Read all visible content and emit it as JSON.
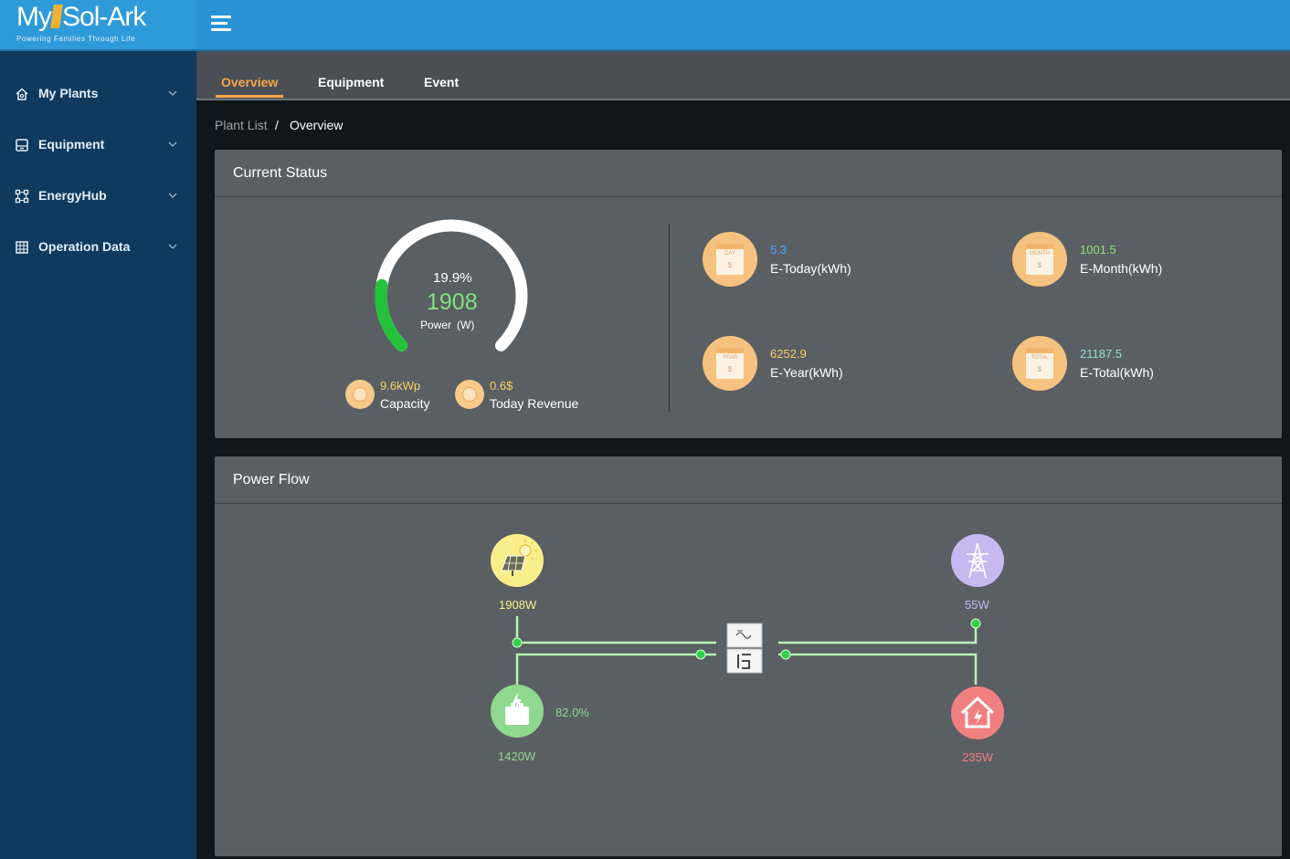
{
  "app": {
    "logo_text_a": "My",
    "logo_text_b": "Sol-Ark",
    "logo_tagline": "Powering Families Through Life"
  },
  "sidebar": {
    "items": [
      {
        "label": "My Plants",
        "icon": "home-icon"
      },
      {
        "label": "Equipment",
        "icon": "equipment-icon"
      },
      {
        "label": "EnergyHub",
        "icon": "network-icon"
      },
      {
        "label": "Operation Data",
        "icon": "grid-table-icon"
      }
    ]
  },
  "tabs": [
    {
      "label": "Overview",
      "active": true
    },
    {
      "label": "Equipment",
      "active": false
    },
    {
      "label": "Event",
      "active": false
    }
  ],
  "breadcrumb": {
    "parent": "Plant List",
    "separator": "/",
    "current": "Overview"
  },
  "current_status": {
    "title": "Current Status",
    "gauge": {
      "percent_text": "19.9%",
      "percent_value": 19.9,
      "value": "1908",
      "label": "Power",
      "unit": "(W)"
    },
    "capacity": {
      "value": "9.6kWp",
      "label": "Capacity"
    },
    "revenue": {
      "value": "0.6$",
      "label": "Today Revenue"
    },
    "stats": [
      {
        "value": "5.3",
        "label": "E-Today(kWh)",
        "caption": "DAY",
        "color": "#4fa8ff"
      },
      {
        "value": "1001.5",
        "label": "E-Month(kWh)",
        "caption": "MONTH",
        "color": "#8fe07f"
      },
      {
        "value": "6252.9",
        "label": "E-Year(kWh)",
        "caption": "YEAR",
        "color": "#f8d26a"
      },
      {
        "value": "21187.5",
        "label": "E-Total(kWh)",
        "caption": "TOTAL",
        "color": "#8fe0d8"
      }
    ]
  },
  "power_flow": {
    "title": "Power Flow",
    "pv": {
      "value": "1908W",
      "color": "#f8ef8c"
    },
    "grid": {
      "value": "55W",
      "color": "#c8b8f0"
    },
    "battery": {
      "value": "1420W",
      "soc": "82.0%",
      "color": "#8fd88f"
    },
    "load": {
      "value": "235W",
      "color": "#f08080"
    }
  },
  "colors": {
    "accent": "#f5a84a",
    "topbar": "#2a93d5",
    "sidebar": "#0f3a5e",
    "gauge_fill": "#22c23a",
    "flow_line": "#b9f0b4"
  }
}
